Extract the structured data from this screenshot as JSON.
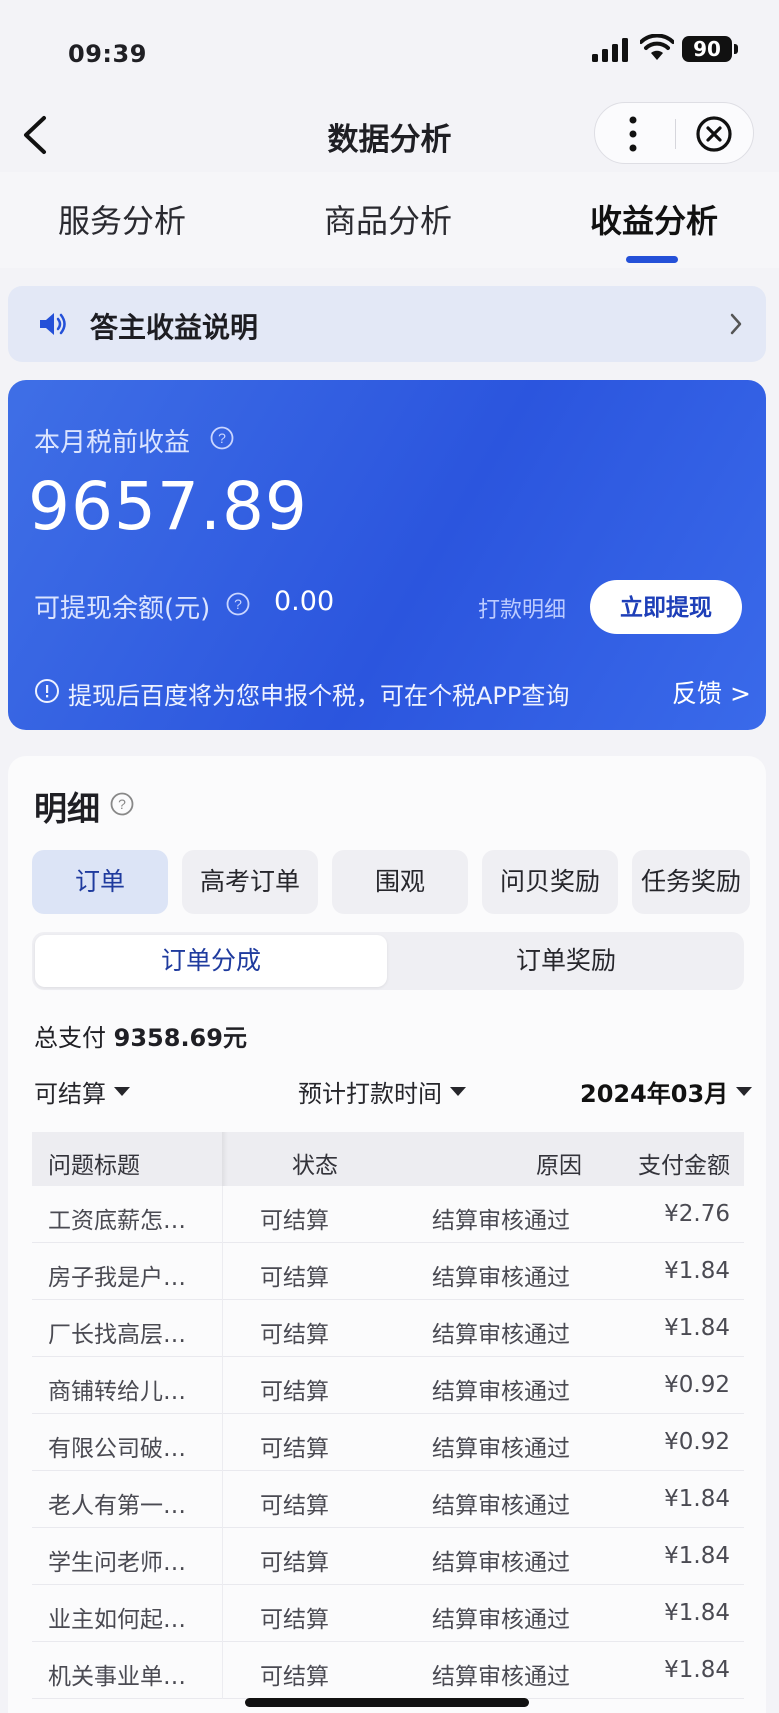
{
  "status_bar": {
    "time": "09:39",
    "battery": "90"
  },
  "nav": {
    "title": "数据分析"
  },
  "tabs": [
    {
      "label": "服务分析"
    },
    {
      "label": "商品分析"
    },
    {
      "label": "收益分析"
    }
  ],
  "notice": {
    "label": "答主收益说明"
  },
  "earnings": {
    "month_label": "本月税前收益",
    "amount": "9657.89",
    "withdrawable_label": "可提现余额(元)",
    "withdrawable_value": "0.00",
    "payment_detail": "打款明细",
    "withdraw_button": "立即提现",
    "tax_notice": "提现后百度将为您申报个税，可在个税APP查询",
    "feedback": "反馈 >"
  },
  "detail": {
    "title": "明细",
    "chips": [
      "订单",
      "高考订单",
      "围观",
      "问贝奖励",
      "任务奖励"
    ],
    "segments": [
      "订单分成",
      "订单奖励"
    ],
    "total_label": "总支付",
    "total_value": "9358.69元",
    "filters": {
      "settle": "可结算",
      "pay_time": "预计打款时间",
      "month": "2024年03月"
    },
    "columns": [
      "问题标题",
      "状态",
      "原因",
      "支付金额"
    ],
    "rows": [
      {
        "title": "工资底薪怎…",
        "status": "可结算",
        "reason": "结算审核通过",
        "amount": "¥2.76"
      },
      {
        "title": "房子我是户…",
        "status": "可结算",
        "reason": "结算审核通过",
        "amount": "¥1.84"
      },
      {
        "title": "厂长找高层…",
        "status": "可结算",
        "reason": "结算审核通过",
        "amount": "¥1.84"
      },
      {
        "title": "商铺转给儿…",
        "status": "可结算",
        "reason": "结算审核通过",
        "amount": "¥0.92"
      },
      {
        "title": "有限公司破…",
        "status": "可结算",
        "reason": "结算审核通过",
        "amount": "¥0.92"
      },
      {
        "title": "老人有第一…",
        "status": "可结算",
        "reason": "结算审核通过",
        "amount": "¥1.84"
      },
      {
        "title": "学生问老师…",
        "status": "可结算",
        "reason": "结算审核通过",
        "amount": "¥1.84"
      },
      {
        "title": "业主如何起…",
        "status": "可结算",
        "reason": "结算审核通过",
        "amount": "¥1.84"
      },
      {
        "title": "机关事业单…",
        "status": "可结算",
        "reason": "结算审核通过",
        "amount": "¥1.84"
      }
    ]
  },
  "colors": {
    "accent": "#2450d8",
    "card_blue": "#2b55de"
  }
}
